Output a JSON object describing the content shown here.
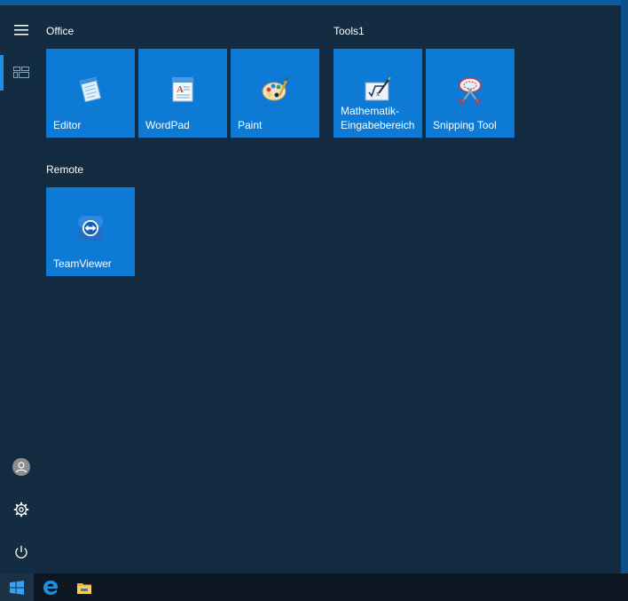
{
  "groups": [
    {
      "title": "Office",
      "tiles": [
        {
          "label": "Editor"
        },
        {
          "label": "WordPad"
        },
        {
          "label": "Paint"
        }
      ]
    },
    {
      "title": "Tools1",
      "tiles": [
        {
          "label": "Mathematik-\nEingabebereich"
        },
        {
          "label": "Snipping Tool"
        }
      ]
    },
    {
      "title": "Remote",
      "tiles": [
        {
          "label": "TeamViewer"
        }
      ]
    }
  ],
  "colors": {
    "tile": "#0d7ad6",
    "menu_background": "#142c42",
    "accent": "#1f8fe8",
    "taskbar": "#0c1722"
  },
  "icons": {
    "rail": [
      "hamburger-icon",
      "tiles-icon",
      "user-avatar-icon",
      "gear-icon",
      "power-icon"
    ],
    "taskbar": [
      "windows-logo-icon",
      "edge-icon",
      "file-explorer-icon"
    ]
  }
}
